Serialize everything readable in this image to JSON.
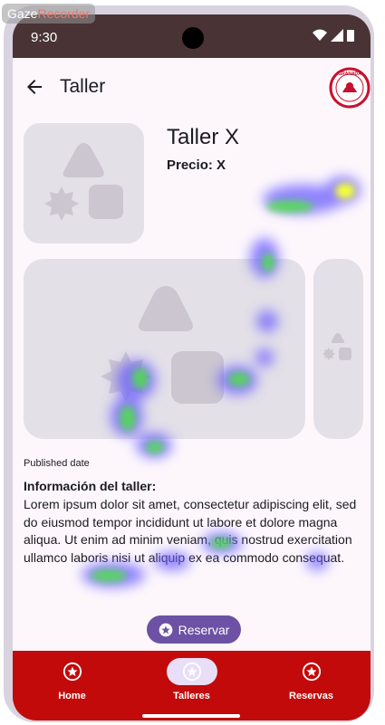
{
  "watermark": {
    "part1": "Gaze",
    "part2": "Recorder"
  },
  "status_bar": {
    "time": "9:30"
  },
  "app_bar": {
    "title": "Taller",
    "logo_text": "GRANADA"
  },
  "workshop": {
    "name": "Taller X",
    "price": "Precio: X"
  },
  "published_label": "Published date",
  "info": {
    "title": "Información del taller:",
    "body": "Lorem ipsum dolor sit amet, consectetur adipiscing elit, sed do eiusmod tempor incididunt ut labore et dolore magna aliqua. Ut enim ad minim veniam, quis nostrud exercitation ullamco laboris nisi ut aliquip ex ea commodo consequat."
  },
  "reserve_button": {
    "label": "Reservar",
    "icon": "star-circle-icon"
  },
  "bottom_nav": {
    "items": [
      {
        "label": "Home",
        "icon": "star-circle-icon",
        "active": false
      },
      {
        "label": "Talleres",
        "icon": "star-circle-icon",
        "active": true
      },
      {
        "label": "Reservas",
        "icon": "star-circle-icon",
        "active": false
      }
    ]
  },
  "colors": {
    "status_bar": "#4a3335",
    "background": "#fdf7fc",
    "placeholder": "#e3e0e8",
    "accent": "#6d51a4",
    "nav_bar": "#c30a0a",
    "nav_active_pill": "#e8def8"
  }
}
